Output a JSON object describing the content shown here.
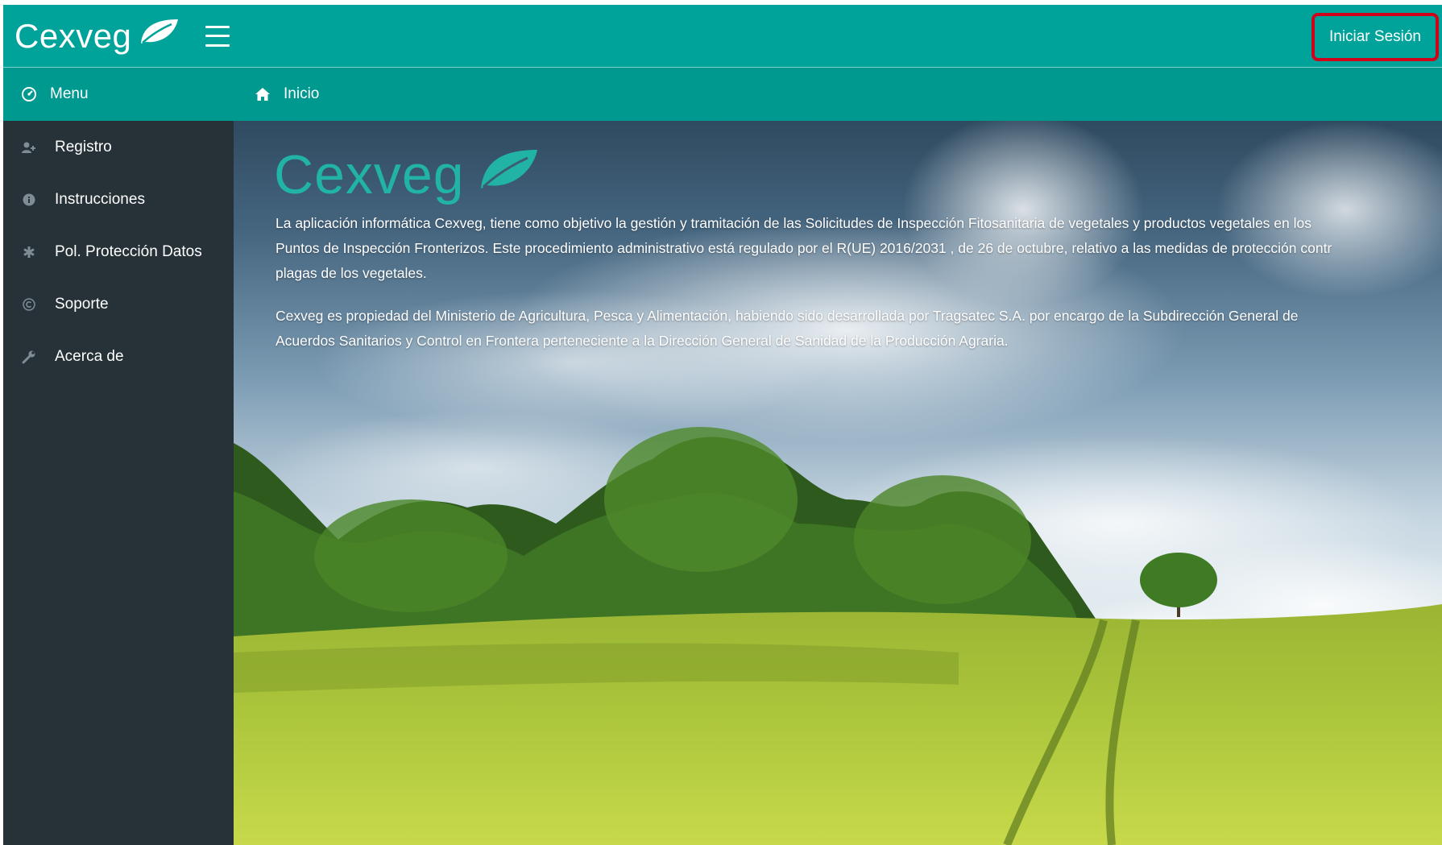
{
  "header": {
    "brand": "Cexveg",
    "login_label": "Iniciar Sesión"
  },
  "subheader": {
    "menu_label": "Menu",
    "breadcrumb_label": "Inicio"
  },
  "sidebar": {
    "items": [
      {
        "label": "Registro",
        "icon": "user-plus-icon"
      },
      {
        "label": "Instrucciones",
        "icon": "info-icon"
      },
      {
        "label": "Pol. Protección Datos",
        "icon": "asterisk-icon"
      },
      {
        "label": "Soporte",
        "icon": "copyright-icon"
      },
      {
        "label": "Acerca de",
        "icon": "wrench-icon"
      }
    ]
  },
  "main": {
    "logo_text": "Cexveg",
    "paragraphs": [
      "La aplicación informática Cexveg, tiene como objetivo la gestión y tramitación de las Solicitudes de Inspección Fitosanitaria de vegetales y productos vegetales en los\nPuntos de Inspección Fronterizos. Este procedimiento administrativo está regulado por el R(UE) 2016/2031 , de 26 de octubre, relativo a las medidas de protección contr\nplagas de los vegetales.",
      "Cexveg es propiedad del Ministerio de Agricultura, Pesca y Alimentación, habiendo sido desarrollada por Tragsatec S.A. por encargo de la Subdirección General de\nAcuerdos Sanitarios y Control en Frontera perteneciente a la Dirección General de Sanidad de la Producción Agraria."
    ]
  },
  "colors": {
    "header": "#00a39a",
    "subheader": "#00998f",
    "sidebar": "#263138",
    "highlight_border": "#d0021b",
    "logo_teal": "#20b3a6"
  }
}
